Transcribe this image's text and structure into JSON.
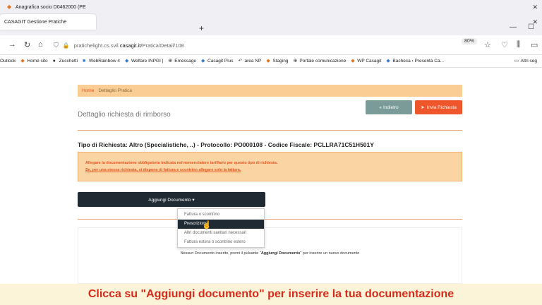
{
  "browser": {
    "tabs": [
      {
        "label": "Anagrafica socio D0462000 (PE",
        "active": false
      },
      {
        "label": "CASAGIT Gestione Pratiche",
        "active": true
      }
    ],
    "tab_close": "✕",
    "new_tab": "+",
    "url_prefix": "pratichelight.cs.svil.",
    "url_domain": "casagit.it",
    "url_path": "/Pratica/Detail/108",
    "zoom": "80%",
    "bookmarks": [
      "Outlook",
      "Home sito",
      "Zucchetti",
      "WebRainbow 4",
      "Welfare INPGI |",
      "Emessage",
      "Casagit Plus",
      "area NP",
      "Staging",
      "Portale comunicazione",
      "WP Casagit",
      "Bacheca ‹ Presenta Ca...",
      "Altri seg"
    ]
  },
  "page": {
    "breadcrumb": {
      "home": "Home",
      "current": "Dettaglio Pratica"
    },
    "title": "Dettaglio richiesta di rimborso",
    "back_label": "Indietro",
    "send_label": "Invia Richiesta",
    "request_line": "Tipo di Richiesta: Altro (Specialistiche, ..) - Protocollo: PO000108 - Codice Fiscale: PCLLRA71C51H501Y",
    "alert_line1": "Allegare la documentazione obbligatoria indicata nel nomenclatore tariffario per questo tipo di richiesta.",
    "alert_line2": "Se, per una stessa richiesta, si dispone di fattura e scontrino allegare solo la fattura.",
    "add_doc_label": "Aggiungi Documento ▾",
    "menu_items": [
      "Fattura o scontrino",
      "Prescrizione",
      "Altri documenti sanitari necessari",
      "Fattura estera o scontrino estero"
    ],
    "empty_pre": "Nessun Documento inserito, premi il pulsante \"",
    "empty_bold": "Aggiungi Documento",
    "empty_post": "\" per inserire un nuovo documento"
  },
  "caption": "Clicca su \"Aggiungi documento\" per inserire la tua documentazione"
}
